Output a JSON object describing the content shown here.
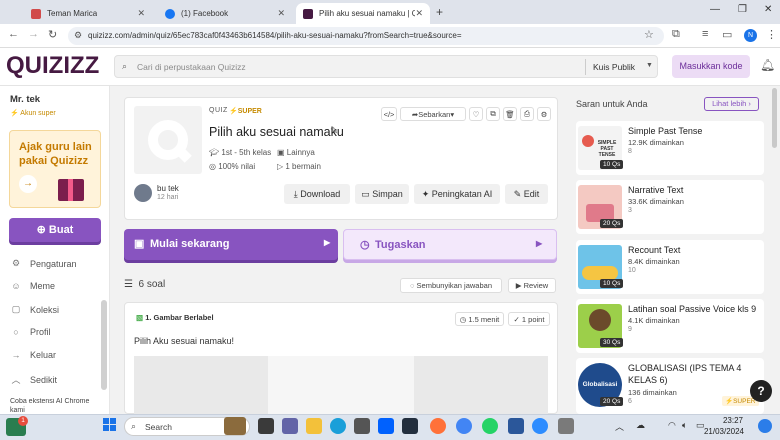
{
  "browser": {
    "tabs": [
      {
        "title": "Teman Marica",
        "color": "#d14b4b"
      },
      {
        "title": "(1) Facebook",
        "color": "#1877f2"
      },
      {
        "title": "Pilih aku sesuai namaku | Quizizz",
        "color": "#461a42"
      }
    ],
    "new_tab": "+",
    "url": "quizizz.com/admin/quiz/65ec783caf0f43463b614584/pilih-aku-sesuai-namaku?fromSearch=true&source=",
    "profile_initial": "N"
  },
  "header": {
    "logo": "QUIZIZZ",
    "search_placeholder": "Cari di perpustakaan Quizizz",
    "search_scope": "Kuis Publik",
    "join_label": "Masukkan kode"
  },
  "sidebar": {
    "user_name": "Mr. tek",
    "account": "Akun super",
    "promo": "Ajak guru lain pakai Quizizz",
    "promo_arrow": "→",
    "create_label": "Buat",
    "items": [
      {
        "label": "Pengaturan",
        "icon": "⚙"
      },
      {
        "label": "Meme",
        "icon": "☺"
      },
      {
        "label": "Koleksi",
        "icon": "▢"
      },
      {
        "label": "Profil",
        "icon": "○"
      },
      {
        "label": "Keluar",
        "icon": "→"
      }
    ],
    "collapse_label": "Sedikit",
    "footer": "Coba ekstensi AI Chrome kami"
  },
  "quiz": {
    "type": "QUIZ",
    "super": "SUPER",
    "title": "Pilih aku sesuai namaku",
    "grade": "1st - 5th kelas",
    "subject": "Lainnya",
    "accuracy": "100% nilai",
    "plays": "1 bermain",
    "author": "bu tek",
    "age": "12 hari",
    "share_label": "Sebarkan",
    "actions": {
      "download": "Download",
      "save": "Simpan",
      "ai": "Peningkatan AI",
      "edit": "Edit"
    },
    "start_label": "Mulai sekarang",
    "assign_label": "Tugaskan",
    "question_count": "6 soal",
    "hide_answers": "Sembunyikan jawaban",
    "review": "Review"
  },
  "question": {
    "number_type": "1. Gambar Berlabel",
    "time": "1.5 menit",
    "points": "1 point",
    "text": "Pilih Aku sesuai namaku!"
  },
  "suggestions": {
    "heading": "Saran untuk Anda",
    "more": "Lihat lebih",
    "items": [
      {
        "title": "Simple Past Tense",
        "plays": "12.9K dimainkan",
        "count": "8",
        "qs": "10 Qs",
        "img_text": "SIMPLE PAST TENSE",
        "color": "#f3f3f3"
      },
      {
        "title": "Narrative Text",
        "plays": "33.6K dimainkan",
        "count": "3",
        "qs": "20 Qs",
        "img_text": "",
        "color": "#f4c9c2"
      },
      {
        "title": "Recount Text",
        "plays": "8.4K dimainkan",
        "count": "10",
        "qs": "10 Qs",
        "img_text": "",
        "color": "#6ec3e8"
      },
      {
        "title": "Latihan soal Passive Voice kls 9",
        "plays": "4.1K dimainkan",
        "count": "9",
        "qs": "30 Qs",
        "img_text": "",
        "color": "#9ccf4a"
      },
      {
        "title": "GLOBALISASI (IPS TEMA 4 KELAS 6)",
        "plays": "136 dimainkan",
        "count": "6",
        "qs": "20 Qs",
        "img_text": "Globalisasi",
        "color": "#1f4b8c",
        "badge": "SUPER"
      }
    ]
  },
  "taskbar": {
    "search_placeholder": "Search",
    "notify_count": "1",
    "time": "23:27",
    "date": "21/03/2024",
    "help": "?"
  }
}
